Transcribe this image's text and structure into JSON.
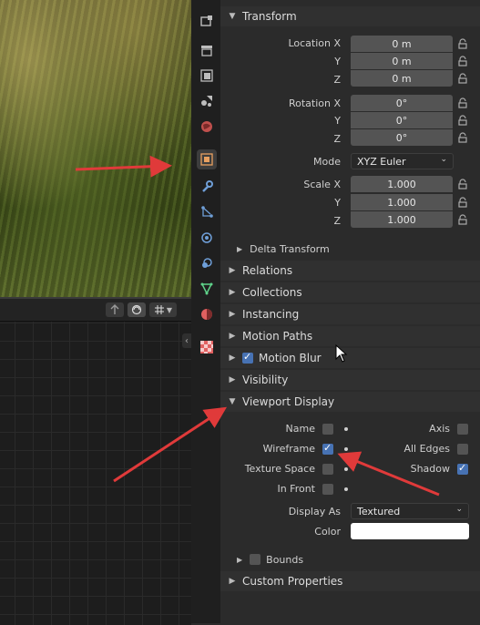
{
  "colors": {
    "accent": "#4772b3",
    "arrow": "#e03a3a",
    "panel_bg": "#2b2b2b",
    "field_bg": "#545454"
  },
  "viewport": {
    "image": "grass-photo"
  },
  "node_editor": {
    "header_icons": [
      "arrow-up-icon",
      "overlay-icon",
      "snap-grid-icon"
    ],
    "collapse_icon": "chevron-left-icon"
  },
  "tabs": [
    {
      "name": "tool-icon"
    },
    {
      "name": "render-icon"
    },
    {
      "name": "output-icon"
    },
    {
      "name": "view-layer-icon"
    },
    {
      "name": "scene-icon"
    },
    {
      "name": "world-icon"
    },
    {
      "name": "object-icon",
      "active": true
    },
    {
      "name": "modifier-icon"
    },
    {
      "name": "particles-icon"
    },
    {
      "name": "physics-icon"
    },
    {
      "name": "constraints-icon"
    },
    {
      "name": "data-icon"
    },
    {
      "name": "material-icon"
    },
    {
      "name": "texture-icon"
    }
  ],
  "transform": {
    "header": "Transform",
    "location_label": "Location X",
    "y_label": "Y",
    "z_label": "Z",
    "location": [
      "0 m",
      "0 m",
      "0 m"
    ],
    "rotation_label": "Rotation X",
    "rotation": [
      "0°",
      "0°",
      "0°"
    ],
    "mode_label": "Mode",
    "mode_value": "XYZ Euler",
    "scale_label": "Scale X",
    "scale": [
      "1.000",
      "1.000",
      "1.000"
    ],
    "delta": "Delta Transform"
  },
  "sections": {
    "relations": "Relations",
    "collections": "Collections",
    "instancing": "Instancing",
    "motion_paths": "Motion Paths",
    "motion_blur": "Motion Blur",
    "visibility": "Visibility",
    "viewport_display": "Viewport Display",
    "custom_properties": "Custom Properties"
  },
  "viewport_display": {
    "name_label": "Name",
    "name_checked": false,
    "axis_label": "Axis",
    "axis_checked": false,
    "wireframe_label": "Wireframe",
    "wireframe_checked": true,
    "all_edges_label": "All Edges",
    "all_edges_checked": false,
    "texture_space_label": "Texture Space",
    "texture_space_checked": false,
    "shadow_label": "Shadow",
    "shadow_checked": true,
    "in_front_label": "In Front",
    "in_front_checked": false,
    "display_as_label": "Display As",
    "display_as_value": "Textured",
    "color_label": "Color",
    "color_value": "#ffffff",
    "bounds_label": "Bounds",
    "bounds_checked": false
  }
}
